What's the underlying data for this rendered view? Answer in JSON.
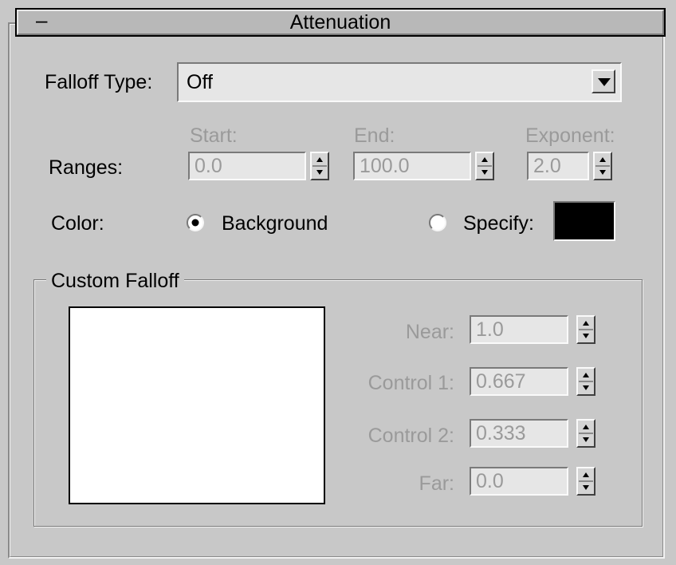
{
  "rollout": {
    "collapse_symbol": "–",
    "title": "Attenuation"
  },
  "falloff_type": {
    "label": "Falloff Type:",
    "value": "Off"
  },
  "ranges": {
    "label": "Ranges:",
    "start": {
      "label": "Start:",
      "value": "0.0"
    },
    "end": {
      "label": "End:",
      "value": "100.0"
    },
    "exponent": {
      "label": "Exponent:",
      "value": "2.0"
    }
  },
  "color": {
    "label": "Color:",
    "background_label": "Background",
    "specify_label": "Specify:",
    "selected": "background",
    "swatch_color": "#000000"
  },
  "custom_falloff": {
    "group_label": "Custom Falloff",
    "near": {
      "label": "Near:",
      "value": "1.0"
    },
    "control1": {
      "label": "Control 1:",
      "value": "0.667"
    },
    "control2": {
      "label": "Control 2:",
      "value": "0.333"
    },
    "far": {
      "label": "Far:",
      "value": "0.0"
    }
  },
  "icons": {
    "dropdown": "triangle-down-icon",
    "spinner": "spinner-up-down-icon",
    "radio_on": "radio-checked-icon",
    "radio_off": "radio-unchecked-icon"
  }
}
